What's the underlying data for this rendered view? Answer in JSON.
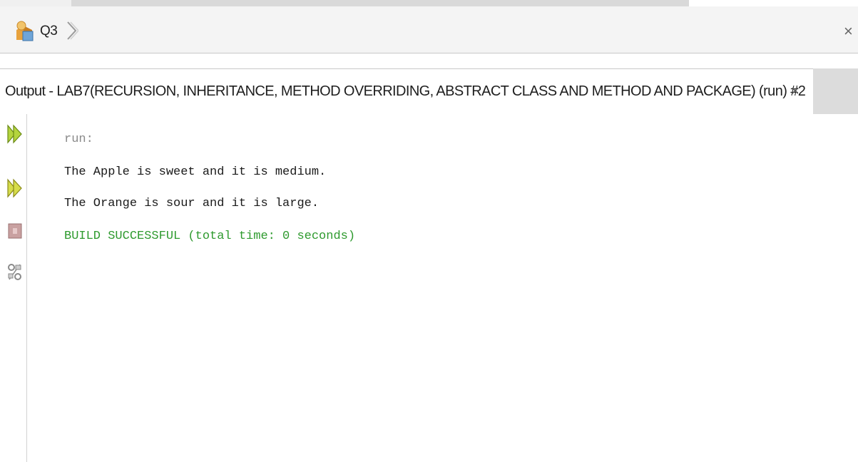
{
  "breadcrumb": {
    "project_label": "Q3"
  },
  "output_tab": {
    "title": "Output - LAB7(RECURSION, INHERITANCE, METHOD OVERRIDING, ABSTRACT CLASS AND METHOD AND PACKAGE) (run) #2",
    "close_glyph": "×"
  },
  "breadcrumb_close_glyph": "×",
  "gutter": {
    "buttons": [
      {
        "icon": "rerun-icon"
      },
      {
        "icon": "rerun-with-options-icon"
      },
      {
        "icon": "stop-icon"
      },
      {
        "icon": "settings-icon"
      }
    ]
  },
  "console": {
    "lines": [
      {
        "text": "run:",
        "kind": "info"
      },
      {
        "text": "The Apple is sweet and it is medium.",
        "kind": "stdout"
      },
      {
        "text": "The Orange is sour and it is large.",
        "kind": "stdout"
      },
      {
        "text": "BUILD SUCCESSFUL (total time: 0 seconds)",
        "kind": "success"
      }
    ]
  },
  "colors": {
    "info": "#8a8a8a",
    "stdout": "#1a1a1a",
    "success": "#2e9a2e",
    "run_icon": "#a9c93a"
  }
}
